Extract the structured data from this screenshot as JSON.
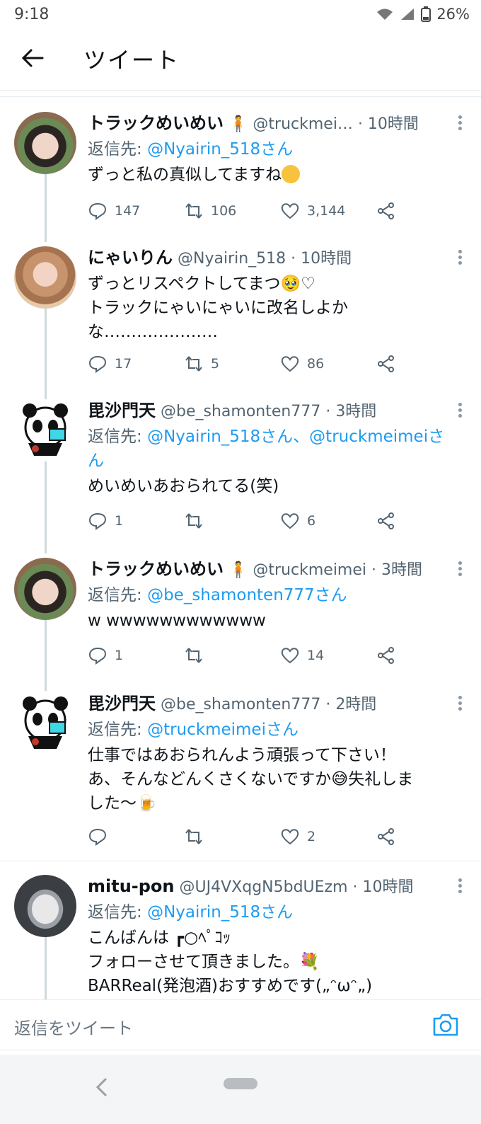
{
  "status": {
    "time": "9:18",
    "battery": "26%"
  },
  "header": {
    "title": "ツイート"
  },
  "tweets": [
    {
      "display_name": "トラックめいめい",
      "handle": "@truckmei…",
      "time": "· 10時間",
      "reply_label": "返信先:",
      "reply_to": "@Nyairin_518さん",
      "lines": [
        "ずっと私の真似してますね"
      ],
      "replies": "147",
      "retweets": "106",
      "likes": "3,144",
      "avatar_color": "#6b5a4e"
    },
    {
      "display_name": "にゃいりん",
      "handle": "@Nyairin_518",
      "time": "· 10時間",
      "reply_label": "",
      "reply_to": "",
      "lines": [
        "ずっとリスペクトしてまつ🥹♡",
        "トラックにゃいにゃいに改名しよか",
        "な…………………"
      ],
      "replies": "17",
      "retweets": "5",
      "likes": "86",
      "avatar_color": "#d8a88c"
    },
    {
      "display_name": "毘沙門天",
      "handle": "@be_shamonten777",
      "time": "· 3時間",
      "reply_label": "返信先:",
      "reply_to": "@Nyairin_518さん、@truckmeimeiさ",
      "reply_to_cont": "ん",
      "lines": [
        "めいめいあおられてる(笑)"
      ],
      "replies": "1",
      "retweets": "",
      "likes": "6",
      "avatar_color": "#ffffff"
    },
    {
      "display_name": "トラックめいめい",
      "handle": "@truckmeimei",
      "time": "· 3時間",
      "reply_label": "返信先:",
      "reply_to": "@be_shamonten777さん",
      "lines": [
        "w wwwwwwwwwwww"
      ],
      "replies": "1",
      "retweets": "",
      "likes": "14",
      "avatar_color": "#6b5a4e"
    },
    {
      "display_name": "毘沙門天",
      "handle": "@be_shamonten777",
      "time": "· 2時間",
      "reply_label": "返信先:",
      "reply_to": "@truckmeimeiさん",
      "lines": [
        "仕事ではあおられんよう頑張って下さい！",
        "あ、そんなどんくさくないですか😅失礼しま",
        "した〜🍺"
      ],
      "replies": "",
      "retweets": "",
      "likes": "2",
      "avatar_color": "#ffffff"
    },
    {
      "display_name": "mitu-pon",
      "handle": "@UJ4VXqgN5bdUEzm",
      "time": "· 10時間",
      "reply_label": "返信先:",
      "reply_to": "@Nyairin_518さん",
      "lines": [
        "こんばんは ┏○ﾍﾟｺｯ",
        "フォローさせて頂きました。💐",
        "BARReal(発泡酒)おすすめです(„ᵔωᵔ„)"
      ],
      "replies": "",
      "retweets": "",
      "likes": "",
      "avatar_color": "#3b3f44"
    }
  ],
  "compose": {
    "placeholder": "返信をツイート"
  }
}
